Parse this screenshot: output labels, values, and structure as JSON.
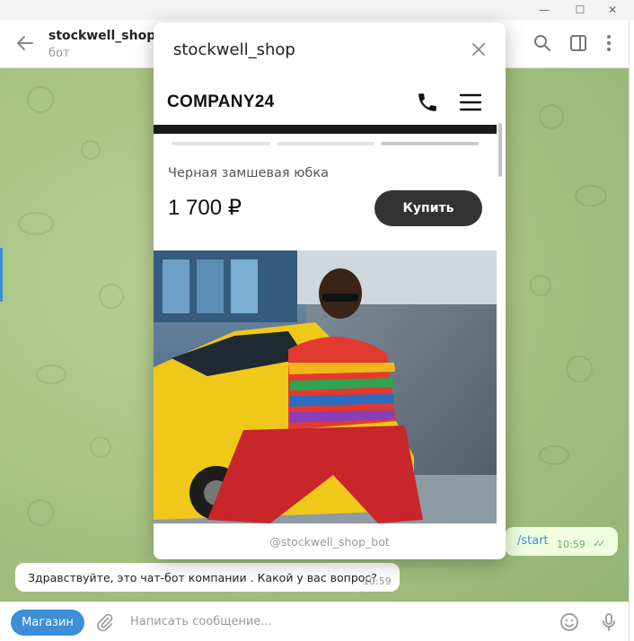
{
  "window": {
    "minimize_glyph": "—",
    "maximize_glyph": "☐",
    "close_glyph": "✕"
  },
  "header": {
    "title": "stockwell_shop",
    "subtitle": "бот",
    "icons": [
      "back-arrow-icon",
      "search-icon",
      "sidebar-toggle-icon",
      "more-vertical-icon"
    ]
  },
  "popup": {
    "title": "stockwell_shop",
    "brand": "COMPANY24",
    "product_name": "Черная замшевая юбка",
    "price": "1 700 ₽",
    "buy_label": "Купить",
    "footer": "@stockwell_shop_bot",
    "carousel_total": 3,
    "carousel_active": 3
  },
  "messages": {
    "outgoing": {
      "text": "/start",
      "time": "10:59",
      "status": "read"
    },
    "incoming": {
      "text": "Здравствуйте, это чат-бот компании . Какой у вас вопрос?",
      "time": "10:59"
    }
  },
  "composer": {
    "menu_button": "Магазин",
    "placeholder": "Написать сообщение..."
  },
  "colors": {
    "accent": "#3a8fd6",
    "chat_bg": "#a9c483",
    "buy_button": "#333333",
    "outgoing_bubble": "#eefedf"
  }
}
